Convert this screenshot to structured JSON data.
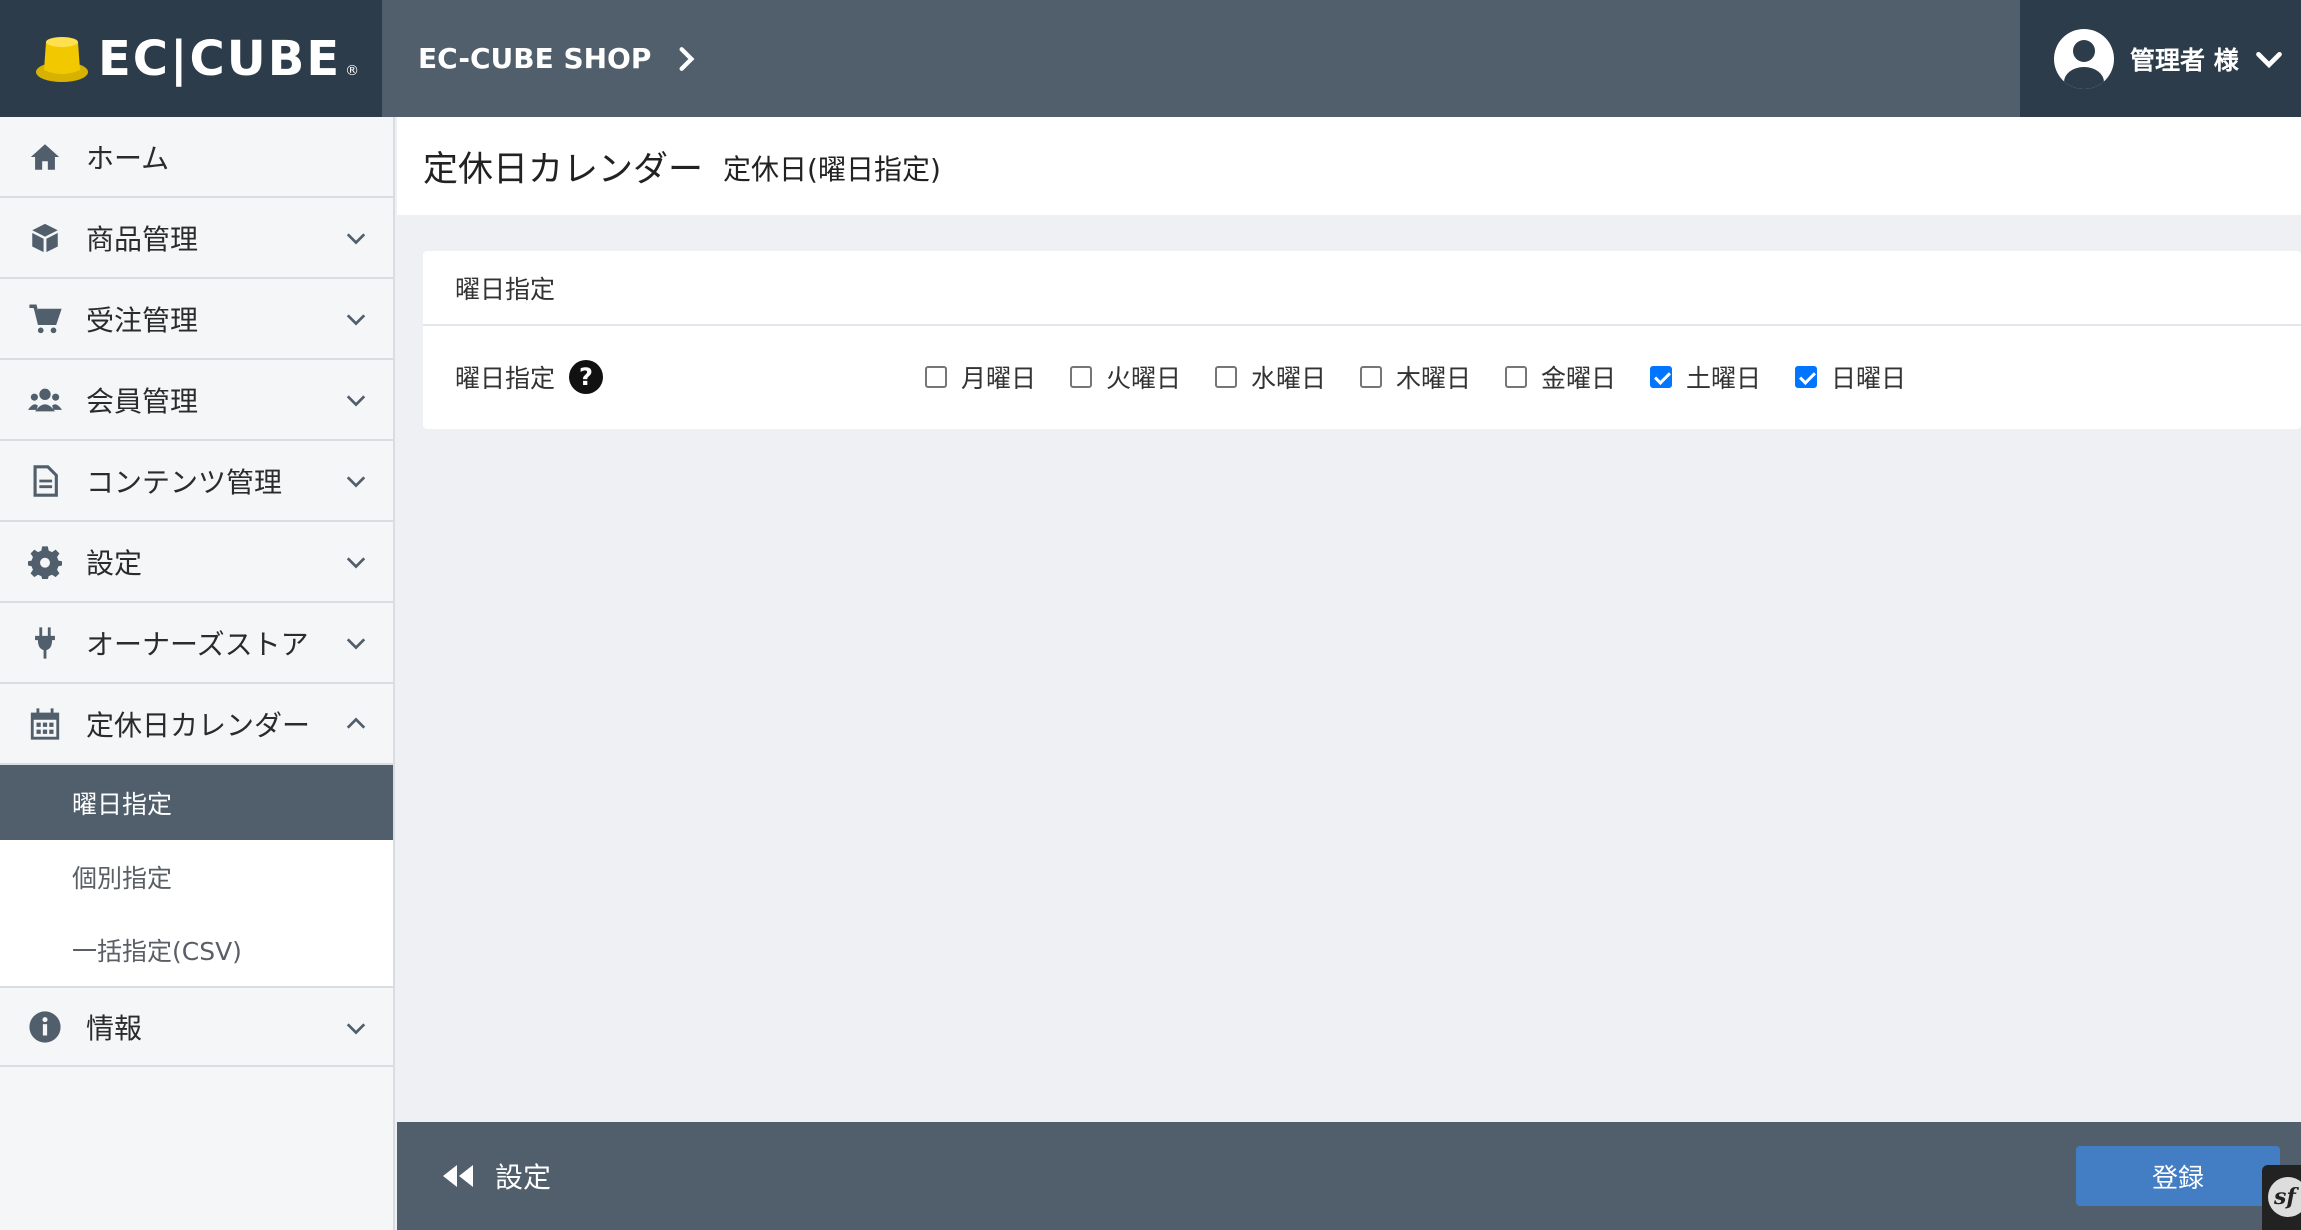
{
  "header": {
    "logo_text": "EC|CUBE",
    "logo_reg": "®",
    "shop_name": "EC-CUBE SHOP",
    "user_label": "管理者 様"
  },
  "sidebar": {
    "items": [
      {
        "label": "ホーム",
        "icon": "home-icon"
      },
      {
        "label": "商品管理",
        "icon": "box-icon"
      },
      {
        "label": "受注管理",
        "icon": "cart-icon"
      },
      {
        "label": "会員管理",
        "icon": "users-icon"
      },
      {
        "label": "コンテンツ管理",
        "icon": "document-icon"
      },
      {
        "label": "設定",
        "icon": "gear-icon"
      },
      {
        "label": "オーナーズストア",
        "icon": "plug-icon"
      },
      {
        "label": "定休日カレンダー",
        "icon": "calendar-icon",
        "expanded": true
      },
      {
        "label": "情報",
        "icon": "info-icon"
      }
    ],
    "subitems": [
      {
        "label": "曜日指定",
        "active": true
      },
      {
        "label": "個別指定",
        "active": false
      },
      {
        "label": "一括指定(CSV)",
        "active": false
      }
    ]
  },
  "main": {
    "title": "定休日カレンダー",
    "subtitle": "定休日(曜日指定)",
    "card_header": "曜日指定",
    "row_label": "曜日指定",
    "help_glyph": "?",
    "weekdays": [
      {
        "label": "月曜日",
        "checked": false
      },
      {
        "label": "火曜日",
        "checked": false
      },
      {
        "label": "水曜日",
        "checked": false
      },
      {
        "label": "木曜日",
        "checked": false
      },
      {
        "label": "金曜日",
        "checked": false
      },
      {
        "label": "土曜日",
        "checked": true
      },
      {
        "label": "日曜日",
        "checked": true
      }
    ]
  },
  "footer": {
    "back_label": "設定",
    "submit_label": "登録",
    "sf_glyph": "sf"
  },
  "colors": {
    "header_bg": "#515e6b",
    "header_dark": "#2d3c4a",
    "primary_button": "#437ec4",
    "checkbox_checked": "#0075ff",
    "page_bg": "#eef0f3"
  }
}
